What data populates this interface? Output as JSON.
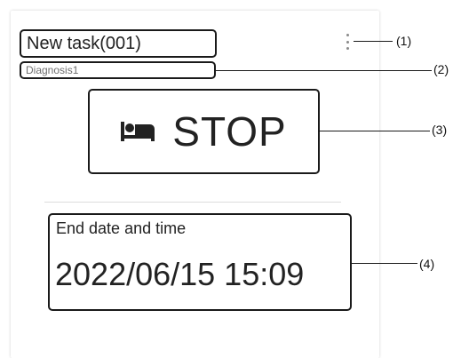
{
  "task": {
    "title": "New task(001)",
    "subtitle": "Diagnosis1",
    "menu_icon": "kebab-menu-icon"
  },
  "status": {
    "icon": "bed-icon",
    "label": "STOP"
  },
  "end": {
    "label": "End date and time",
    "value": "2022/06/15 15:09"
  },
  "callouts": {
    "c1": "(1)",
    "c2": "(2)",
    "c3": "(3)",
    "c4": "(4)"
  }
}
